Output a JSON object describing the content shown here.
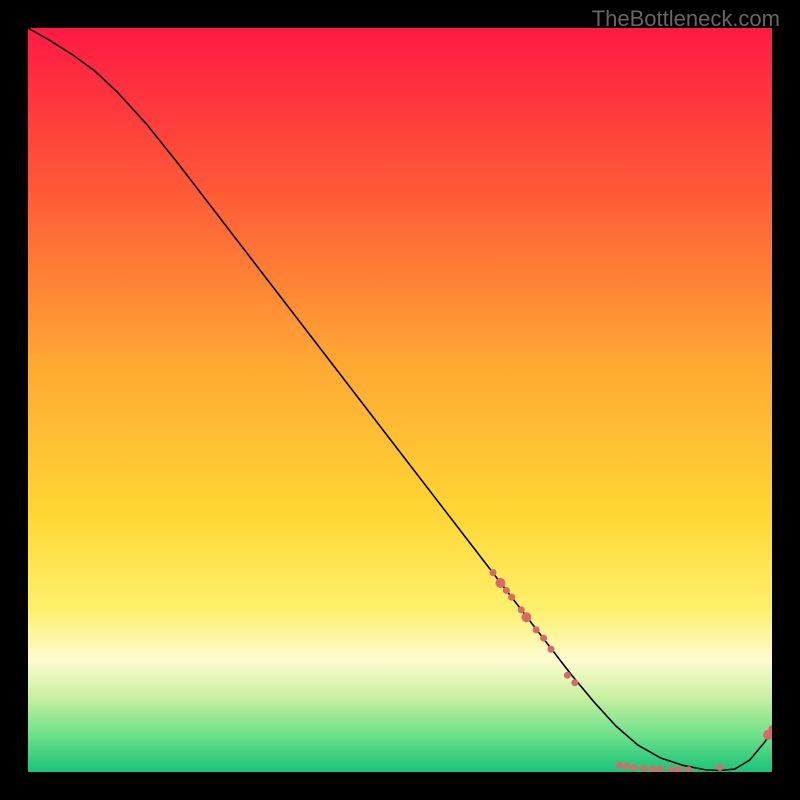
{
  "watermark": "TheBottleneck.com",
  "chart_data": {
    "type": "line",
    "title": "",
    "xlabel": "",
    "ylabel": "",
    "xlim": [
      0,
      100
    ],
    "ylim": [
      0,
      100
    ],
    "grid": false,
    "legend": false,
    "gradient_background": {
      "top": "#ff1a44",
      "mid_upper": "#ff7a33",
      "mid": "#ffd633",
      "mid_lower": "#fff27a",
      "near_bottom": "#6ee06e",
      "bottom": "#18c47a"
    },
    "series": [
      {
        "name": "curve",
        "type": "line",
        "color": "#000000",
        "x": [
          0,
          3,
          6,
          9,
          12,
          16,
          20,
          25,
          30,
          35,
          40,
          45,
          50,
          55,
          60,
          65,
          70,
          73,
          76,
          79,
          82,
          85,
          88,
          91,
          93,
          95,
          97,
          99,
          100
        ],
        "values": [
          100,
          98.3,
          96.4,
          94.2,
          91.4,
          87,
          82,
          75.5,
          69,
          62.5,
          56,
          49.5,
          43,
          36.5,
          30,
          23.5,
          17,
          13.1,
          9.5,
          6.2,
          3.6,
          1.9,
          0.9,
          0.3,
          0.2,
          0.4,
          1.6,
          4.0,
          5.5
        ]
      },
      {
        "name": "markers",
        "type": "scatter",
        "color": "#d66a6a",
        "size_small": 3.5,
        "size_large": 5,
        "points": [
          {
            "x": 62.5,
            "y": 26.8,
            "r": 3.5
          },
          {
            "x": 63.5,
            "y": 25.4,
            "r": 5
          },
          {
            "x": 64.3,
            "y": 24.4,
            "r": 3.5
          },
          {
            "x": 65.0,
            "y": 23.5,
            "r": 3.5
          },
          {
            "x": 66.3,
            "y": 21.8,
            "r": 3.5
          },
          {
            "x": 67.0,
            "y": 20.8,
            "r": 5
          },
          {
            "x": 68.3,
            "y": 19.1,
            "r": 3.5
          },
          {
            "x": 69.3,
            "y": 18.0,
            "r": 3.5
          },
          {
            "x": 70.3,
            "y": 16.5,
            "r": 3.5
          },
          {
            "x": 72.5,
            "y": 13.0,
            "r": 3.5
          },
          {
            "x": 73.5,
            "y": 12.0,
            "r": 3.5
          },
          {
            "x": 79.5,
            "y": 0.9,
            "r": 3.5
          },
          {
            "x": 80.5,
            "y": 0.8,
            "r": 3.5
          },
          {
            "x": 81.5,
            "y": 0.6,
            "r": 3.5
          },
          {
            "x": 82.8,
            "y": 0.5,
            "r": 3.5
          },
          {
            "x": 84.0,
            "y": 0.4,
            "r": 3.5
          },
          {
            "x": 85.0,
            "y": 0.4,
            "r": 3.5
          },
          {
            "x": 86.5,
            "y": 0.3,
            "r": 3.5
          },
          {
            "x": 87.5,
            "y": 0.3,
            "r": 3.5
          },
          {
            "x": 88.8,
            "y": 0.3,
            "r": 3.5
          },
          {
            "x": 93.0,
            "y": 0.6,
            "r": 3.5
          },
          {
            "x": 99.5,
            "y": 5.0,
            "r": 5
          },
          {
            "x": 100.0,
            "y": 5.8,
            "r": 3.5
          }
        ]
      }
    ]
  }
}
